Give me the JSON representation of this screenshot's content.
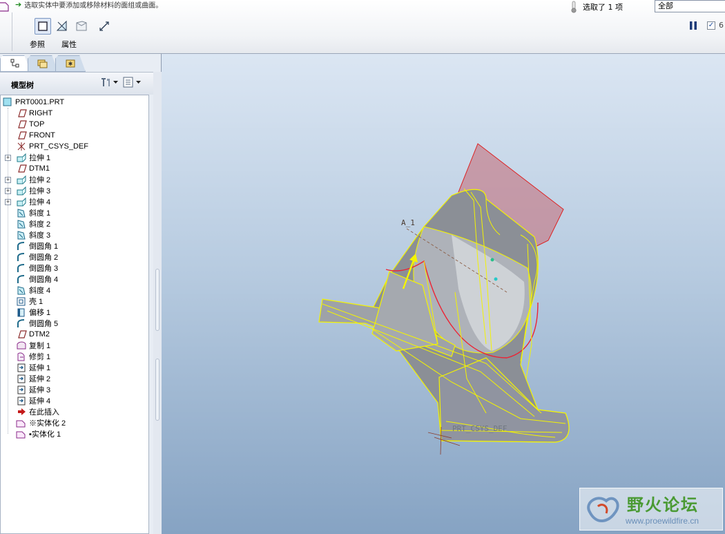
{
  "dashboard": {
    "prompt": "选取实体中要添加或移除材料的面组或曲面。",
    "tabs": [
      {
        "label": "参照"
      },
      {
        "label": "属性"
      }
    ],
    "selection_text": "选取了 1 项",
    "filter_value": "全部",
    "checkbox_checked": true
  },
  "navigator": {
    "tabs": [
      {
        "icon": "model-tree-tab-icon"
      },
      {
        "icon": "folder-browser-tab-icon"
      },
      {
        "icon": "favorites-tab-icon"
      }
    ]
  },
  "model_tree": {
    "title": "模型树",
    "items": [
      {
        "label": "PRT0001.PRT",
        "icon": "part-icon",
        "expandable": false,
        "root": true
      },
      {
        "label": "RIGHT",
        "icon": "datum-plane-icon",
        "expandable": false
      },
      {
        "label": "TOP",
        "icon": "datum-plane-icon",
        "expandable": false
      },
      {
        "label": "FRONT",
        "icon": "datum-plane-icon",
        "expandable": false
      },
      {
        "label": "PRT_CSYS_DEF",
        "icon": "coordinate-system-icon",
        "expandable": false
      },
      {
        "label": "拉伸 1",
        "icon": "extrude-icon",
        "expandable": true
      },
      {
        "label": "DTM1",
        "icon": "datum-plane-icon",
        "expandable": false
      },
      {
        "label": "拉伸 2",
        "icon": "extrude-icon",
        "expandable": true
      },
      {
        "label": "拉伸 3",
        "icon": "extrude-icon",
        "expandable": true
      },
      {
        "label": "拉伸 4",
        "icon": "extrude-icon",
        "expandable": true
      },
      {
        "label": "斜度 1",
        "icon": "draft-icon",
        "expandable": false
      },
      {
        "label": "斜度 2",
        "icon": "draft-icon",
        "expandable": false
      },
      {
        "label": "斜度 3",
        "icon": "draft-icon",
        "expandable": false
      },
      {
        "label": "倒圆角 1",
        "icon": "round-icon",
        "expandable": false
      },
      {
        "label": "倒圆角 2",
        "icon": "round-icon",
        "expandable": false
      },
      {
        "label": "倒圆角 3",
        "icon": "round-icon",
        "expandable": false
      },
      {
        "label": "倒圆角 4",
        "icon": "round-icon",
        "expandable": false
      },
      {
        "label": "斜度 4",
        "icon": "draft-icon",
        "expandable": false
      },
      {
        "label": "壳 1",
        "icon": "shell-icon",
        "expandable": false
      },
      {
        "label": "偏移 1",
        "icon": "offset-icon",
        "expandable": false
      },
      {
        "label": "倒圆角 5",
        "icon": "round-icon",
        "expandable": false
      },
      {
        "label": "DTM2",
        "icon": "datum-plane-icon",
        "expandable": false
      },
      {
        "label": "复制 1",
        "icon": "copy-icon",
        "expandable": false
      },
      {
        "label": "修剪 1",
        "icon": "trim-icon",
        "expandable": false
      },
      {
        "label": "延伸 1",
        "icon": "extend-icon",
        "expandable": false
      },
      {
        "label": "延伸 2",
        "icon": "extend-icon",
        "expandable": false
      },
      {
        "label": "延伸 3",
        "icon": "extend-icon",
        "expandable": false
      },
      {
        "label": "延伸 4",
        "icon": "extend-icon",
        "expandable": false
      },
      {
        "label": "在此插入",
        "icon": "insert-here-arrow-icon",
        "expandable": false
      },
      {
        "label": "※实体化 2",
        "icon": "solidify-icon",
        "expandable": false
      },
      {
        "label": "▪实体化 1",
        "icon": "solidify-icon",
        "expandable": false
      }
    ]
  },
  "viewport": {
    "axis_label": "A_1",
    "csys_label": "PRT_CSYS_DEF"
  },
  "watermark": {
    "title": "野火论坛",
    "url": "www.proewildfire.cn"
  },
  "colors": {
    "highlight_yellow": "#f4f400",
    "surface_red": "#d86a78",
    "viewport_top": "#dbe6f3",
    "viewport_bottom": "#86a3c3"
  }
}
